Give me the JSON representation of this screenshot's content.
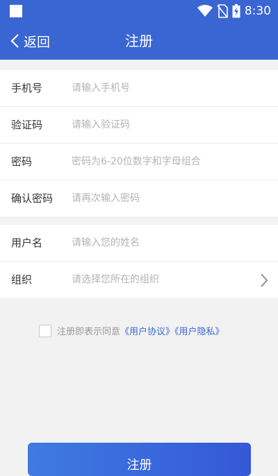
{
  "statusbar": {
    "time": "8:30"
  },
  "header": {
    "back_label": "返回",
    "title": "注册"
  },
  "form_group1": [
    {
      "label": "手机号",
      "placeholder": "请输入手机号"
    },
    {
      "label": "验证码",
      "placeholder": "请输入验证码"
    },
    {
      "label": "密码",
      "placeholder": "密码为6-20位数字和字母组合"
    },
    {
      "label": "确认密码",
      "placeholder": "请再次输入密码"
    }
  ],
  "form_group2": [
    {
      "label": "用户名",
      "placeholder": "请输入您的姓名"
    },
    {
      "label": "组织",
      "placeholder": "请选择您所在的组织"
    }
  ],
  "agreement": {
    "text": "注册即表示同意",
    "user_agreement": "《用户协议》",
    "user_privacy": "《用户隐私》"
  },
  "submit_label": "注册",
  "colors": {
    "primary": "#3a66d4",
    "background": "#f2f2f2"
  }
}
